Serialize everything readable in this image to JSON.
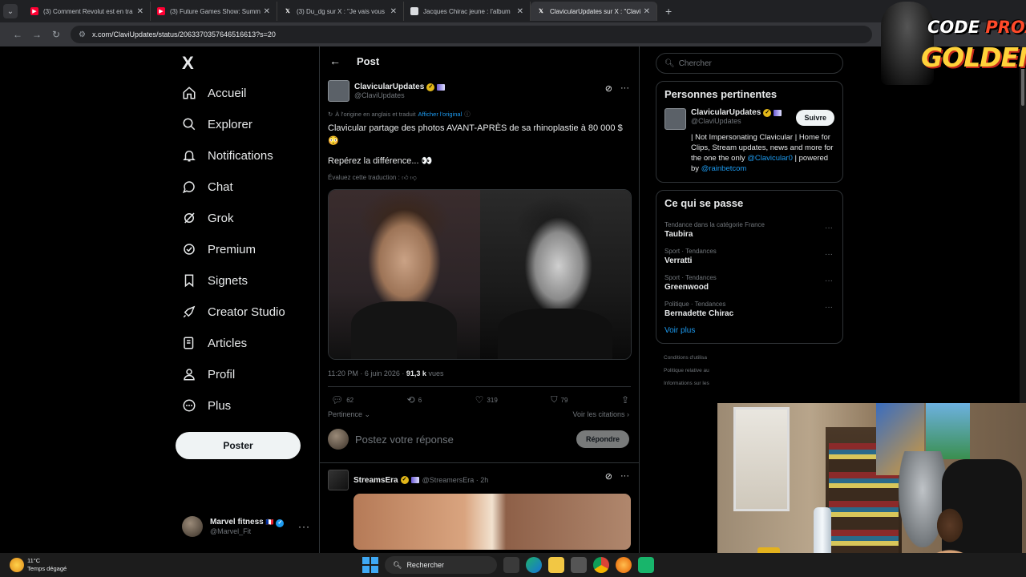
{
  "browser": {
    "tabs": [
      {
        "label": "(3) Comment Revolut est en tra",
        "favicon": "yt",
        "active": false
      },
      {
        "label": "(3) Future Games Show: Summ",
        "favicon": "yt",
        "active": false
      },
      {
        "label": "(3) Du_dg sur X : \"Je vais vous",
        "favicon": "x",
        "active": false
      },
      {
        "label": "Jacques Chirac jeune : l'album",
        "favicon": "doc",
        "active": false
      },
      {
        "label": "ClavicularUpdates sur X : \"Clavi",
        "favicon": "x",
        "active": true
      }
    ],
    "url": "x.com/ClaviUpdates/status/2063370357646516613?s=20"
  },
  "nav": {
    "logo": "X",
    "items": [
      {
        "label": "Accueil",
        "icon": "home-icon"
      },
      {
        "label": "Explorer",
        "icon": "search-icon"
      },
      {
        "label": "Notifications",
        "icon": "bell-icon"
      },
      {
        "label": "Chat",
        "icon": "chat-icon"
      },
      {
        "label": "Grok",
        "icon": "grok-icon"
      },
      {
        "label": "Premium",
        "icon": "premium-icon"
      },
      {
        "label": "Signets",
        "icon": "bookmark-icon"
      },
      {
        "label": "Creator Studio",
        "icon": "rocket-icon"
      },
      {
        "label": "Articles",
        "icon": "article-icon"
      },
      {
        "label": "Profil",
        "icon": "person-icon"
      },
      {
        "label": "Plus",
        "icon": "more-circle-icon"
      }
    ],
    "post_button": "Poster",
    "account": {
      "name": "Marvel fitness",
      "handle": "@Marvel_Fit"
    }
  },
  "post": {
    "header_title": "Post",
    "author_name": "ClavicularUpdates",
    "author_handle": "@ClaviUpdates",
    "translated_note": "À l'origine en anglais et traduit",
    "show_original": "Afficher l'original",
    "text": "Clavicular partage des photos AVANT-APRÈS de sa rhinoplastie à 80 000 $ 😳",
    "text2": "Repérez la différence... 👀",
    "rate_translation": "Évaluez cette traduction :",
    "time": "11:20 PM · 6 juin 2026 ·",
    "views_count": "91,3 k",
    "views_label": "vues",
    "stats": {
      "replies": "62",
      "reposts": "6",
      "likes": "319",
      "bookmarks": "79"
    },
    "relevance": "Pertinence",
    "quotes": "Voir les citations",
    "reply_placeholder": "Postez votre réponse",
    "reply_button": "Répondre"
  },
  "reply": {
    "name": "StreamsEra",
    "handle": "@StreamersEra · 2h"
  },
  "sidebar": {
    "search_placeholder": "Chercher",
    "relevant_title": "Personnes pertinentes",
    "person": {
      "name": "ClavicularUpdates",
      "handle": "@ClaviUpdates",
      "follow": "Suivre",
      "bio_1": "| Not Impersonating Clavicular | Home for Clips, Stream updates, news and more for the one the only ",
      "bio_mention_1": "@Clavicular0",
      "bio_2": " | powered by ",
      "bio_mention_2": "@rainbetcom"
    },
    "happening_title": "Ce qui se passe",
    "trends": [
      {
        "context": "Tendance dans la catégorie France",
        "name": "Taubira"
      },
      {
        "context": "Sport · Tendances",
        "name": "Verratti"
      },
      {
        "context": "Sport · Tendances",
        "name": "Greenwood"
      },
      {
        "context": "Politique · Tendances",
        "name": "Bernadette Chirac"
      }
    ],
    "see_more": "Voir plus",
    "footer": [
      "Conditions d'utilisa",
      "Politique relative au",
      "Informations sur les"
    ]
  },
  "taskbar": {
    "temp": "11°C",
    "weather": "Temps dégagé",
    "search": "Rechercher"
  },
  "overlay": {
    "code": "CODE",
    "brand": "PROZIS",
    "promo": "GOLDENG"
  }
}
